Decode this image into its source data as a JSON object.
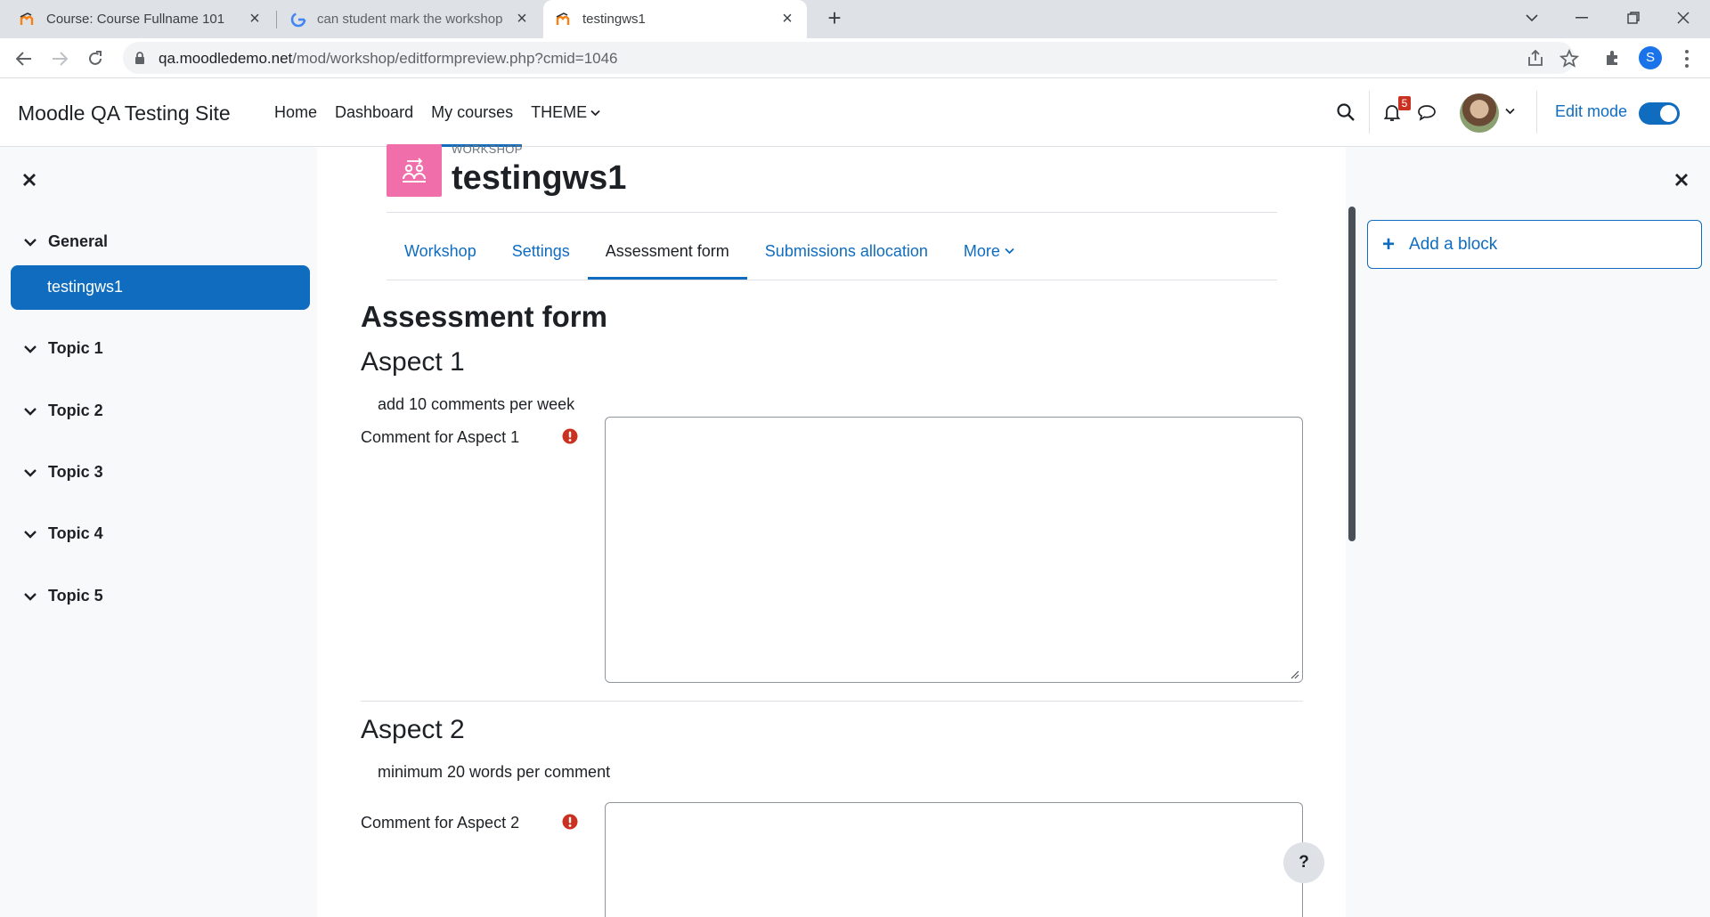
{
  "browser": {
    "tabs": [
      {
        "title": "Course: Course Fullname 101"
      },
      {
        "title": "can student mark the workshop a"
      },
      {
        "title": "testingws1"
      }
    ],
    "url_host": "qa.moodledemo.net",
    "url_path": "/mod/workshop/editformpreview.php?cmid=1046",
    "profile_initial": "S"
  },
  "navbar": {
    "site_name": "Moodle QA Testing Site",
    "items": [
      "Home",
      "Dashboard",
      "My courses",
      "THEME"
    ],
    "notification_count": "5",
    "edit_mode_label": "Edit mode"
  },
  "course_index": {
    "sections": [
      {
        "label": "General"
      },
      {
        "label": "Topic 1"
      },
      {
        "label": "Topic 2"
      },
      {
        "label": "Topic 3"
      },
      {
        "label": "Topic 4"
      },
      {
        "label": "Topic 5"
      }
    ],
    "active_activity": "testingws1"
  },
  "header": {
    "module_type": "WORKSHOP",
    "title": "testingws1"
  },
  "secondary_nav": {
    "tabs": [
      "Workshop",
      "Settings",
      "Assessment form",
      "Submissions allocation",
      "More"
    ]
  },
  "form": {
    "heading": "Assessment form",
    "aspects": [
      {
        "title": "Aspect 1",
        "description": "add 10 comments per week",
        "comment_label": "Comment for Aspect 1",
        "value": ""
      },
      {
        "title": "Aspect 2",
        "description": "minimum 20 words per comment",
        "comment_label": "Comment for Aspect 2",
        "value": ""
      }
    ]
  },
  "blocks": {
    "add_block_label": "Add a block"
  },
  "help_label": "?",
  "colors": {
    "brand": "#0f6cbf",
    "workshop_icon": "#f06eaa",
    "required": "#ca3120"
  }
}
